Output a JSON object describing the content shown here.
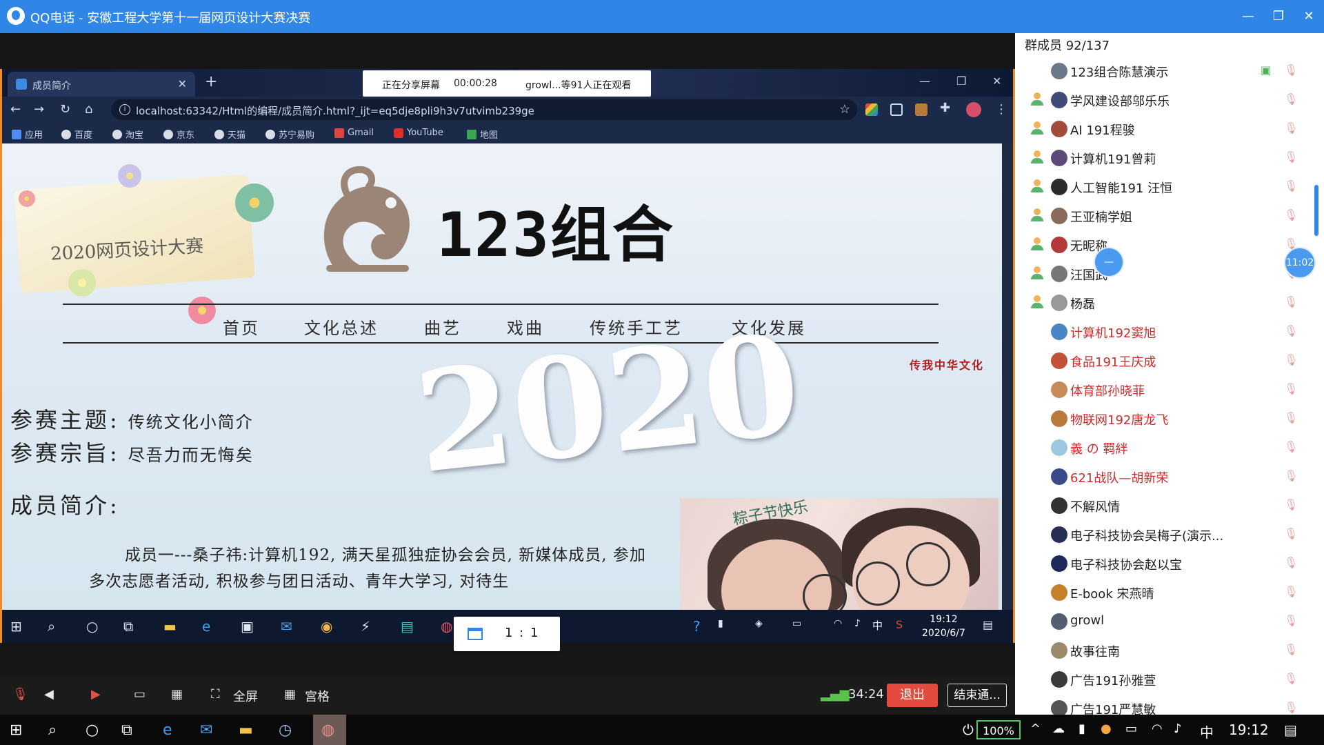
{
  "window": {
    "title": "QQ电话 - 安徽工程大学第十一届网页设计大赛决赛"
  },
  "share_bar": {
    "status": "正在分享屏幕",
    "duration": "00:00:28",
    "viewers": "growl...等91人正在观看"
  },
  "browser": {
    "tab_title": "成员简介",
    "url": "localhost:63342/Html的编程/成员简介.html?_ijt=eq5dje8pli9h3v7utvimb239ge",
    "bookmarks": [
      "应用",
      "百度",
      "淘宝",
      "京东",
      "天猫",
      "苏宁易购",
      "Gmail",
      "YouTube",
      "地图"
    ]
  },
  "page": {
    "banner_text": "2020网页设计大赛",
    "brand": "123组合",
    "nav": [
      "首页",
      "文化总述",
      "曲艺",
      "戏曲",
      "传统手工艺",
      "文化发展"
    ],
    "slogan": "传我中华文化",
    "big_year": "2020",
    "theme_label": "参赛主题:",
    "theme_value": "传统文化小简介",
    "purpose_label": "参赛宗旨:",
    "purpose_value": "尽吾力而无悔矣",
    "members_heading": "成员简介:",
    "member_paragraph": "成员一---桑子祎:计算机192, 满天星孤独症协会会员, 新媒体成员, 参加多次志愿者活动, 积极参与团日活动、青年大学习, 对待生",
    "photo_caption": "粽子节快乐"
  },
  "inner_taskbar": {
    "time": "19:12",
    "date": "2020/6/7",
    "ratio_label": "1 : 1"
  },
  "controls": {
    "fullscreen": "全屏",
    "grid": "宫格",
    "timer": "34:24",
    "exit": "退出",
    "end": "结束通..."
  },
  "members_panel": {
    "header": "群成员 92/137",
    "members": [
      {
        "name": "123组合陈慧演示",
        "host": false,
        "red": false
      },
      {
        "name": "学风建设部邬乐乐",
        "host": true,
        "red": false
      },
      {
        "name": "AI   191程骏",
        "host": true,
        "red": false
      },
      {
        "name": "计算机191曾莉",
        "host": true,
        "red": false
      },
      {
        "name": "人工智能191 汪恒",
        "host": true,
        "red": false
      },
      {
        "name": "王亚楠学姐",
        "host": true,
        "red": false
      },
      {
        "name": "无昵称",
        "host": true,
        "red": false
      },
      {
        "name": "汪国武",
        "host": true,
        "red": false
      },
      {
        "name": "杨磊",
        "host": true,
        "red": false
      },
      {
        "name": "计算机192窦旭",
        "host": false,
        "red": true
      },
      {
        "name": "食品191王庆成",
        "host": false,
        "red": true
      },
      {
        "name": "体育部孙晓菲",
        "host": false,
        "red": true
      },
      {
        "name": "物联网192唐龙飞",
        "host": false,
        "red": true
      },
      {
        "name": "義 の 羁絆",
        "host": false,
        "red": true
      },
      {
        "name": "621战队—胡新荣",
        "host": false,
        "red": true
      },
      {
        "name": "不解风情",
        "host": false,
        "red": false
      },
      {
        "name": "电子科技协会吴梅子(演示...",
        "host": false,
        "red": false
      },
      {
        "name": "电子科技协会赵以宝",
        "host": false,
        "red": false
      },
      {
        "name": "E-book  宋燕晴",
        "host": false,
        "red": false
      },
      {
        "name": "growl",
        "host": false,
        "red": false
      },
      {
        "name": "故事往南",
        "host": false,
        "red": false
      },
      {
        "name": "广告191孙雅萱",
        "host": false,
        "red": false
      },
      {
        "name": "广告191严慧敏",
        "host": false,
        "red": false
      }
    ],
    "bubble_time": "11:02"
  },
  "taskbar": {
    "battery": "100%",
    "ime": "中",
    "time": "19:12"
  }
}
